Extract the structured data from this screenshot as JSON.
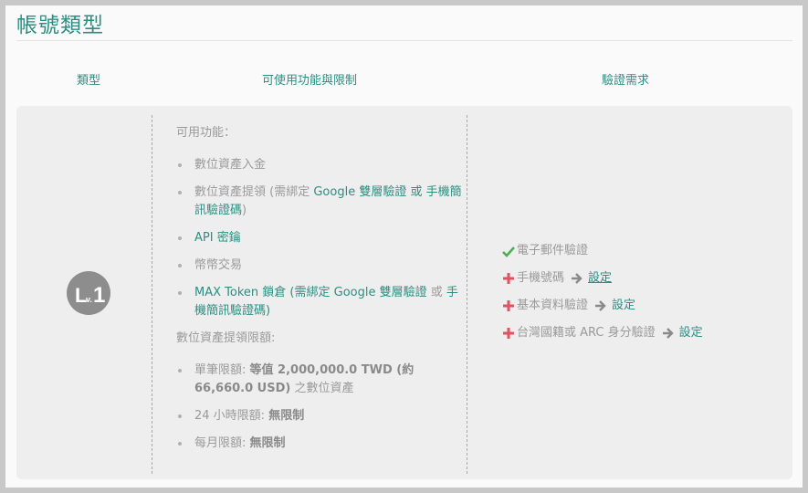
{
  "page": {
    "title": "帳號類型"
  },
  "table": {
    "headers": {
      "type": "類型",
      "features": "可使用功能與限制",
      "requirements": "驗證需求"
    }
  },
  "level": {
    "badge_text": "Lv.1",
    "badge_color": "#8d8d8d"
  },
  "features": {
    "title": "可用功能：",
    "items": [
      {
        "plain": "數位資產入金"
      },
      {
        "pre": "數位資產提領 (需綁定 ",
        "link1": "Google 雙層驗證",
        "mid": " 或 ",
        "link2": "手機簡訊驗證碼",
        "post": ")"
      },
      {
        "link": "API 密鑰"
      },
      {
        "plain": "幣幣交易"
      },
      {
        "link": "MAX Token",
        "pre2": " 鎖倉 (需綁定 ",
        "link1": "Google 雙層驗證",
        "mid": " 或 ",
        "link2": "手機簡訊驗證碼",
        "post": ")"
      }
    ]
  },
  "limits": {
    "title": "數位資產提領限額:",
    "items": [
      {
        "label": "單筆限額: ",
        "value": "等值 2,000,000.0 TWD (約 66,660.0 USD)",
        "suffix": " 之數位資產"
      },
      {
        "label": "24 小時限額: ",
        "value": "無限制"
      },
      {
        "label": "每月限額: ",
        "value": "無限制"
      }
    ]
  },
  "requirements": [
    {
      "status": "done",
      "label": "電子郵件驗證",
      "action": ""
    },
    {
      "status": "todo",
      "label": "手機號碼",
      "action": "設定"
    },
    {
      "status": "todo",
      "label": "基本資料驗證",
      "action": "設定"
    },
    {
      "status": "todo",
      "label": "台灣國籍或 ARC 身分驗證",
      "action": "設定"
    }
  ],
  "colors": {
    "accent": "#2a8f83",
    "done": "#4caf50",
    "todo": "#e05262"
  }
}
